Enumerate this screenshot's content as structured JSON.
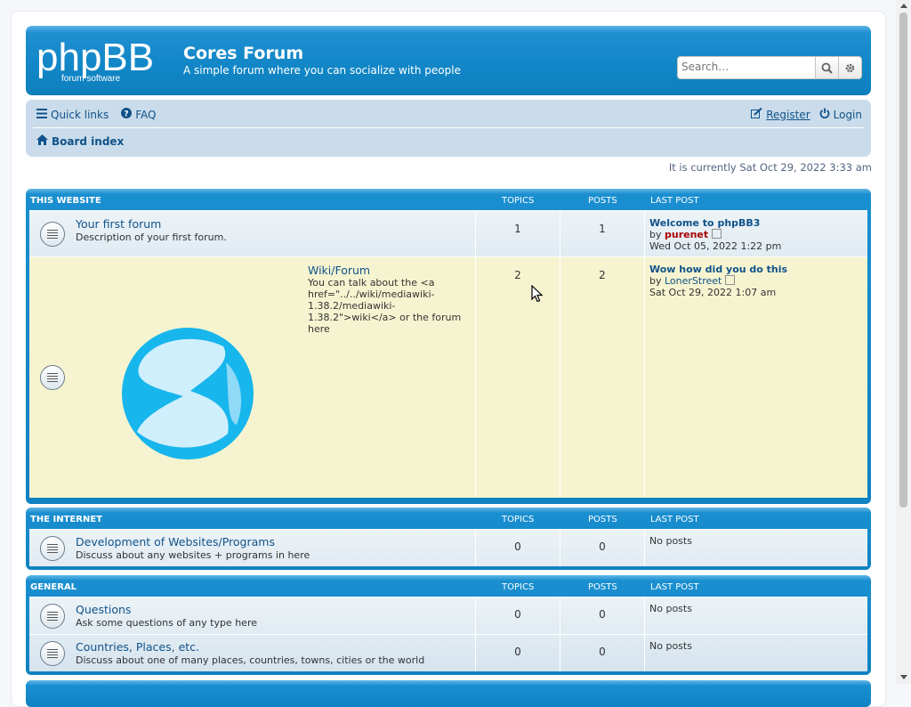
{
  "header": {
    "logo_text": "phpBB",
    "logo_sub": "forum software",
    "title": "Cores Forum",
    "description": "A simple forum where you can socialize with people",
    "search_placeholder": "Search…"
  },
  "nav": {
    "quick_links": "Quick links",
    "faq": "FAQ",
    "register": "Register",
    "login": "Login",
    "board_index": "Board index"
  },
  "time": "It is currently Sat Oct 29, 2022 3:33 am",
  "columns": {
    "topics": "TOPICS",
    "posts": "POSTS",
    "last_post": "LAST POST"
  },
  "categories": [
    {
      "name": "THIS WEBSITE",
      "forums": [
        {
          "title": "Your first forum",
          "desc": "Description of your first forum.",
          "topics": "1",
          "posts": "1",
          "last_title": "Welcome to phpBB3",
          "by": "by",
          "author": "purenet",
          "author_color": "#aa0000",
          "date": "Wed Oct 05, 2022 1:22 pm"
        },
        {
          "title": "Wiki/Forum",
          "desc": "You can talk about the <a href=\"../../wiki/mediawiki-1.38.2/mediawiki-1.38.2\">wiki</a> or the forum here",
          "topics": "2",
          "posts": "2",
          "last_title": "Wow how did you do this",
          "by": "by",
          "author": "LonerStreet",
          "date": "Sat Oct 29, 2022 1:07 am"
        }
      ]
    },
    {
      "name": "THE INTERNET",
      "forums": [
        {
          "title": "Development of Websites/Programs",
          "desc": "Discuss about any websites + programs in here",
          "topics": "0",
          "posts": "0",
          "last": "No posts"
        }
      ]
    },
    {
      "name": "GENERAL",
      "forums": [
        {
          "title": "Questions",
          "desc": "Ask some questions of any type here",
          "topics": "0",
          "posts": "0",
          "last": "No posts"
        },
        {
          "title": "Countries, Places, etc.",
          "desc": "Discuss about one of many places, countries, towns, cities or the world",
          "topics": "0",
          "posts": "0",
          "last": "No posts"
        }
      ]
    }
  ],
  "colors": {
    "header_blue": "#1186c6",
    "nav_bg": "#cadceb",
    "link": "#105289",
    "highlight_row": "#f6f4d0"
  }
}
